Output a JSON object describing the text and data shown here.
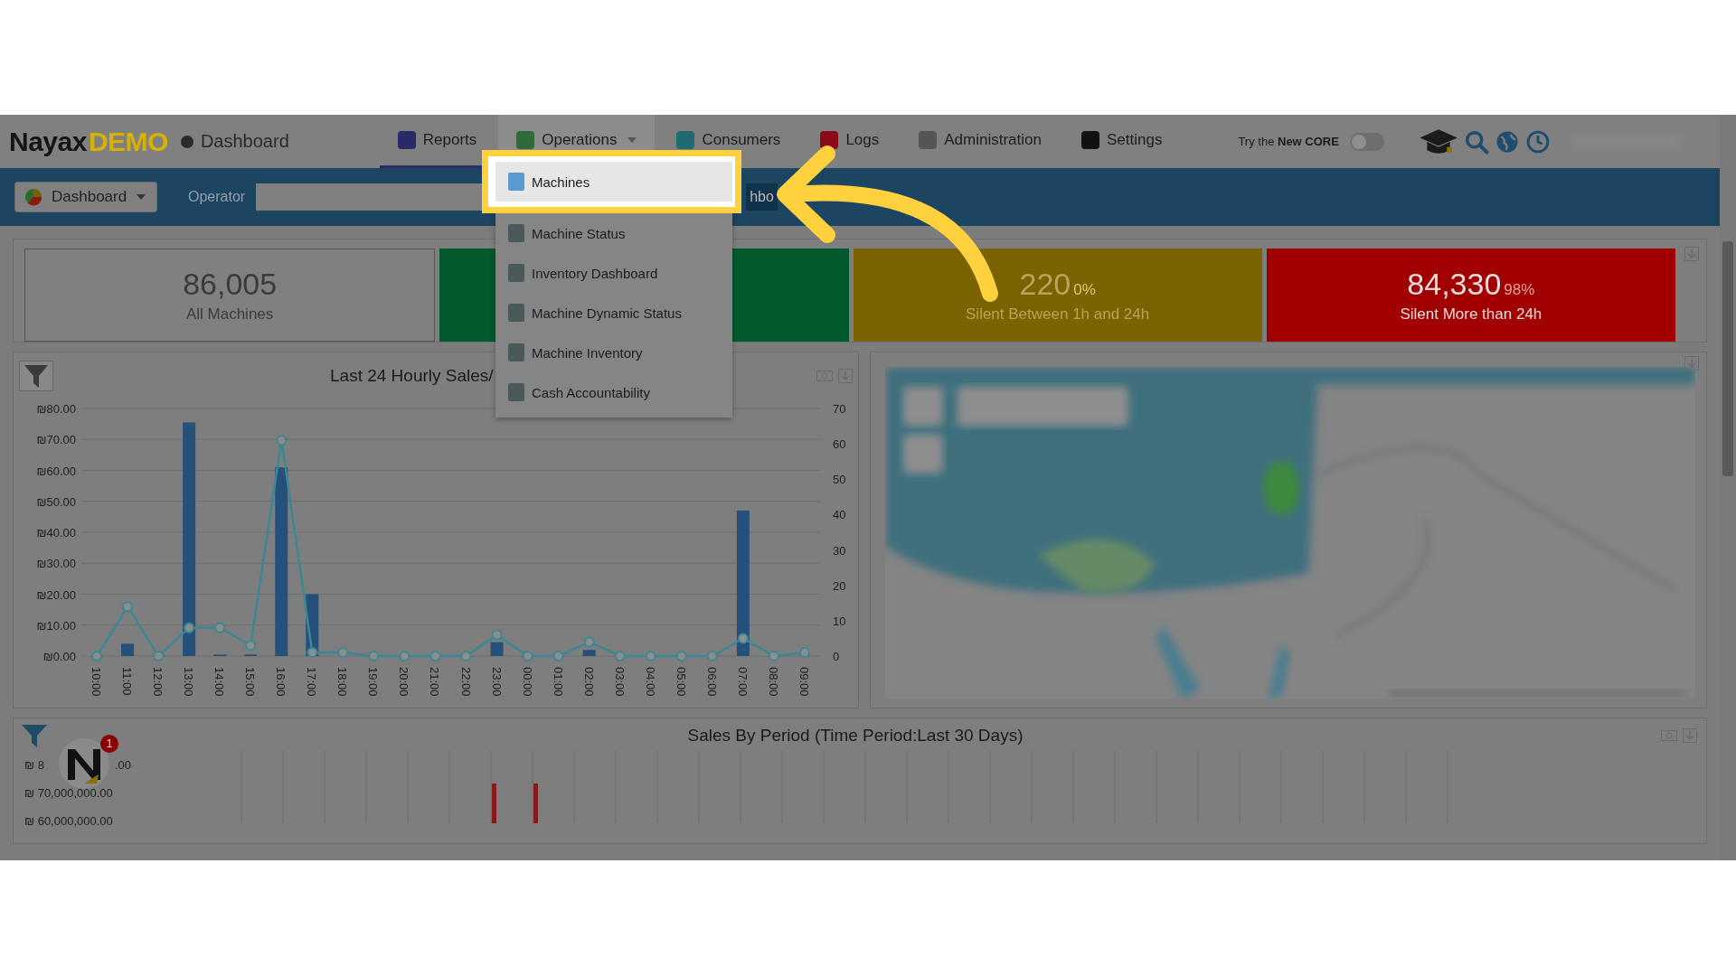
{
  "header": {
    "logo": {
      "name": "Nayax",
      "suffix": "DEMO"
    },
    "page_title": "Dashboard",
    "nav": [
      {
        "label": "Reports",
        "kind": "link",
        "selected": true,
        "expanded": false
      },
      {
        "label": "Operations",
        "kind": "menu",
        "selected": false,
        "expanded": true
      },
      {
        "label": "Consumers",
        "kind": "link",
        "selected": false,
        "expanded": false
      },
      {
        "label": "Logs",
        "kind": "link",
        "selected": false,
        "expanded": false
      },
      {
        "label": "Administration",
        "kind": "link",
        "selected": false,
        "expanded": false
      },
      {
        "label": "Settings",
        "kind": "link",
        "selected": false,
        "expanded": false
      }
    ],
    "core_toggle": {
      "label": "Try the **New CORE**",
      "on": false
    }
  },
  "toolbar": {
    "dashboard_button": "Dashboard",
    "operator_label": "Operator",
    "partial_button": "hbo"
  },
  "operations_menu": [
    {
      "label": "Machines",
      "selected": true
    },
    {
      "label": "Machine Status",
      "selected": false
    },
    {
      "label": "Inventory Dashboard",
      "selected": false
    },
    {
      "label": "Machine Dynamic Status",
      "selected": false
    },
    {
      "label": "Machine Inventory",
      "selected": false
    },
    {
      "label": "Cash Accountability",
      "selected": false
    }
  ],
  "kpis": [
    {
      "kind": "total",
      "value": "86,005",
      "label": "All Machines"
    },
    {
      "kind": "ok"
    },
    {
      "kind": "warning",
      "value": "220",
      "percent": "0%",
      "label": "Silent Between 1h and 24h"
    },
    {
      "kind": "alert",
      "value": "84,330",
      "percent": "98%",
      "label": "Silent More than 24h"
    }
  ],
  "hourly_chart": {
    "title": "Last 24 Hourly Sales/",
    "charts": [
      {
        "chart_data": {
          "type": "bar",
          "grid": true,
          "categories": [
            "10:00",
            "11:00",
            "12:00",
            "13:00",
            "14:00",
            "15:00",
            "16:00",
            "17:00",
            "18:00",
            "19:00",
            "20:00",
            "21:00",
            "22:00",
            "23:00",
            "00:00",
            "01:00",
            "02:00",
            "03:00",
            "04:00",
            "05:00",
            "06:00",
            "07:00",
            "08:00",
            "09:00"
          ],
          "series": [
            {
              "color": "#24507a",
              "values": [
                0,
                4,
                0,
                75.5,
                0.5,
                0.5,
                61,
                20,
                null,
                0,
                0,
                0,
                0,
                4.5,
                0,
                0,
                2,
                0,
                0,
                0,
                0,
                47,
                0,
                null
              ]
            }
          ],
          "ylim": [
            0,
            80
          ],
          "yticks": [
            {
              "value": 0,
              "label": "₪0.00"
            },
            {
              "value": 10,
              "label": "₪10.00"
            },
            {
              "value": 20,
              "label": "₪20.00"
            },
            {
              "value": 30,
              "label": "₪30.00"
            },
            {
              "value": 40,
              "label": "₪40.00"
            },
            {
              "value": 50,
              "label": "₪50.00"
            },
            {
              "value": 60,
              "label": "₪60.00"
            },
            {
              "value": 70,
              "label": "₪70.00"
            },
            {
              "value": 80,
              "label": "₪80.00"
            }
          ]
        }
      },
      {
        "chart_data": {
          "type": "line",
          "series": [
            {
              "color": "#3c8796",
              "marker": "o",
              "values": [
                0,
                14,
                0,
                8,
                8,
                3,
                61,
                1,
                1,
                0,
                0,
                0,
                0,
                6,
                0,
                0,
                4,
                0,
                0,
                0,
                0,
                5,
                0,
                1
              ]
            }
          ],
          "ylim": [
            0,
            70
          ],
          "yticks": [
            0,
            10,
            20,
            30,
            40,
            50,
            60,
            70
          ]
        }
      }
    ]
  },
  "period_chart": {
    "title": "Sales By Period (Time Period:Last 30 Days)",
    "tick_labels": [
      [
        "₪ 8",
        ".00"
      ],
      [
        "₪ 70,000,000.00"
      ],
      [
        "₪ 60,000,000.00"
      ]
    ]
  },
  "assistant": {
    "badge": "1"
  }
}
